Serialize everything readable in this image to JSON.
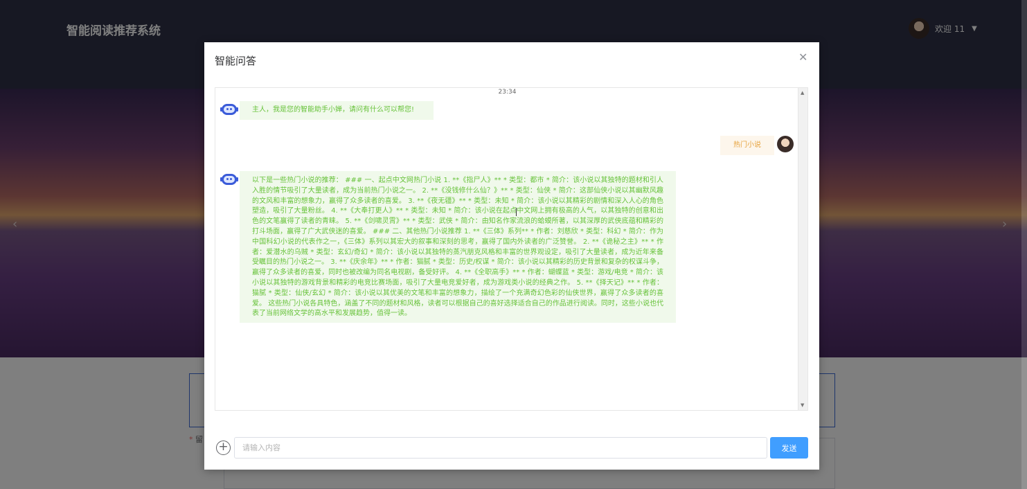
{
  "header": {
    "site_title": "智能阅读推荐系统",
    "welcome": "欢迎 11"
  },
  "background_form": {
    "field_label": "留"
  },
  "dialog": {
    "title": "智能问答",
    "close_icon": "close-icon"
  },
  "chat": {
    "time": "23:34",
    "greeting": "主人，我是您的智能助手小婵，请问有什么可以帮您!",
    "user_message": "热门小说",
    "reply": "以下是一些热门小说的推荐： ### 一、起点中文网热门小说 1. **《指尸人》** * 类型：都市 * 简介：该小说以其独特的题材和引人入胜的情节吸引了大量读者，成为当前热门小说之一。 2. **《没钱修什么仙？》** * 类型：仙侠 * 简介：这部仙侠小说以其幽默风趣的文风和丰富的想象力，赢得了众多读者的喜爱。 3. **《夜无疆》** * 类型：未知 * 简介：该小说以其精彩的剧情和深入人心的角色塑造，吸引了大量粉丝。 4. **《大奉打更人》** * 类型：未知 * 简介：该小说在起点中文网上拥有极高的人气，以其独特的创意和出色的文笔赢得了读者的青睐。 5. **《剑啸灵霄》** * 类型：武侠 * 简介：由知名作家流浪的蛤蟆所著，以其深厚的武侠底蕴和精彩的打斗场面，赢得了广大武侠迷的喜爱。 ### 二、其他热门小说推荐 1. **《三体》系列** * 作者：刘慈欣 * 类型：科幻 * 简介：作为中国科幻小说的代表作之一，《三体》系列以其宏大的叙事和深刻的思考，赢得了国内外读者的广泛赞誉。 2. **《诡秘之主》** * 作者：爱潜水的乌贼 * 类型：玄幻/奇幻 * 简介：该小说以其独特的蒸汽朋克风格和丰富的世界观设定，吸引了大量读者，成为近年来备受瞩目的热门小说之一。 3. **《庆余年》** * 作者：猫腻 * 类型：历史/权谋 * 简介：该小说以其精彩的历史背景和复杂的权谋斗争，赢得了众多读者的喜爱，同时也被改编为同名电视剧，备受好评。 4. **《全职高手》** * 作者：蝴蝶蓝 * 类型：游戏/电竞 * 简介：该小说以其独特的游戏背景和精彩的电竞比赛场面，吸引了大量电竞爱好者，成为游戏类小说的经典之作。 5. **《择天记》** * 作者：猫腻 * 类型：仙侠/玄幻 * 简介：该小说以其优美的文笔和丰富的想象力，描绘了一个充满奇幻色彩的仙侠世界，赢得了众多读者的喜爱。 这些热门小说各具特色，涵盖了不同的题材和风格，读者可以根据自己的喜好选择适合自己的作品进行阅读。同时，这些小说也代表了当前网络文学的高水平和发展趋势，值得一读。"
  },
  "input": {
    "placeholder": "请输入内容",
    "send_label": "发送"
  },
  "colors": {
    "bot_bubble_bg": "#f0f9eb",
    "bot_text": "#67c23a",
    "user_bubble_bg": "#fdf6ec",
    "user_text": "#e6a23c",
    "primary": "#409eff"
  }
}
